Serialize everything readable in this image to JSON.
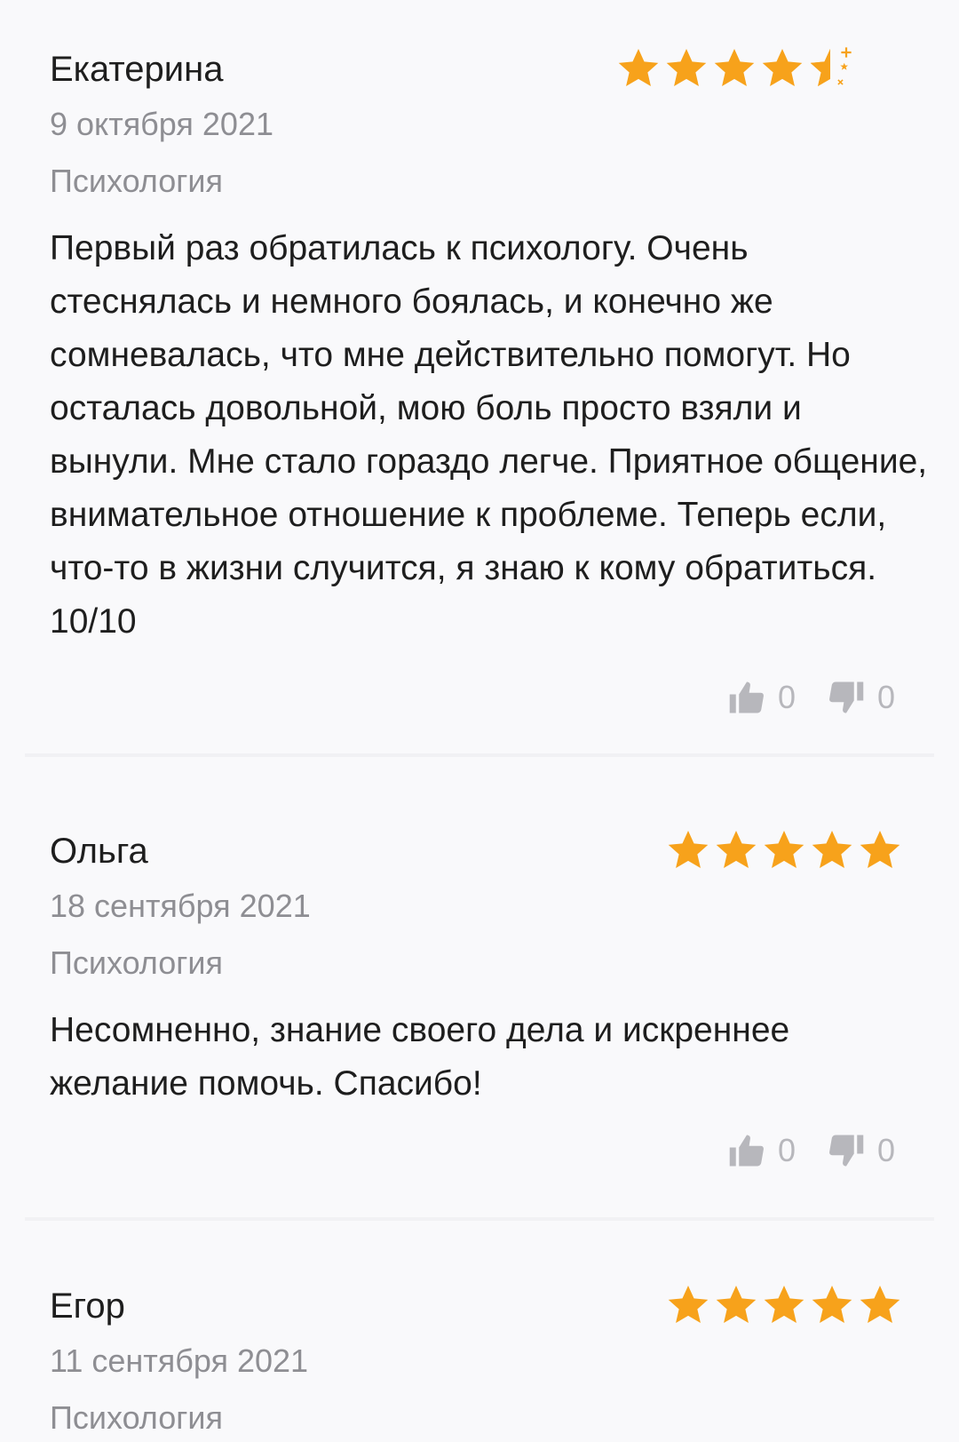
{
  "reviews": [
    {
      "author": "Екатерина",
      "date": "9 октября 2021",
      "category": "Психология",
      "rating": 4.5,
      "text": "Первый раз обратилась к психологу. Очень стеснялась и немного боялась, и конечно же сомневалась, что мне действительно помогут. Но осталась довольной, мою боль просто взяли и вынули. Мне стало гораздо легче. Приятное общение, внимательное отношение к проблеме. Теперь если, что-то в жизни случится, я знаю к кому обратиться. 10/10",
      "likes": "0",
      "dislikes": "0"
    },
    {
      "author": "Ольга",
      "date": "18 сентября 2021",
      "category": "Психология",
      "rating": 5,
      "text": "Несомненно, знание своего дела и искреннее желание помочь. Спасибо!",
      "likes": "0",
      "dislikes": "0"
    },
    {
      "author": "Егор",
      "date": "11 сентября 2021",
      "category": "Психология",
      "rating": 5
    }
  ],
  "colors": {
    "star": "#f7a21b",
    "muted": "#8e8e93",
    "vote": "#b7b7bc"
  },
  "icons": {
    "like": "thumbs-up-icon",
    "dislike": "thumbs-down-icon",
    "star": "star-icon"
  }
}
